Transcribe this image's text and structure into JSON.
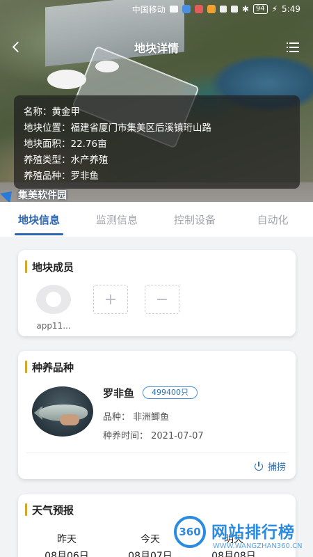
{
  "status_bar": {
    "carrier": "中国移动",
    "battery": "94",
    "time": "5:49"
  },
  "header": {
    "title": "地块详情"
  },
  "map": {
    "place_label": "集美软件园"
  },
  "plot_info": {
    "rows": [
      {
        "label": "名称：",
        "value": "黄金甲"
      },
      {
        "label": "地块位置：",
        "value": "福建省厦门市集美区后溪镇珩山路"
      },
      {
        "label": "地块面积：",
        "value": "22.76亩"
      },
      {
        "label": "养殖类型：",
        "value": "水产养殖"
      },
      {
        "label": "养殖品种：",
        "value": "罗非鱼"
      }
    ]
  },
  "tabs": [
    {
      "label": "地块信息",
      "active": true
    },
    {
      "label": "监测信息",
      "active": false
    },
    {
      "label": "控制设备",
      "active": false
    },
    {
      "label": "自动化",
      "active": false
    }
  ],
  "members_card": {
    "title": "地块成员",
    "member_name": "app11...",
    "add_symbol": "+",
    "remove_symbol": "−"
  },
  "species_card": {
    "title": "种养品种",
    "name": "罗非鱼",
    "count_badge": "499400只",
    "variety_line": "品种：  非洲鲫鱼",
    "time_line": "种养时间：  2021-07-07",
    "harvest_label": "捕捞"
  },
  "weather_card": {
    "title": "天气预报",
    "days": [
      {
        "label": "昨天",
        "date": "08月06日"
      },
      {
        "label": "今天",
        "date": "08月07日"
      },
      {
        "label": "明天",
        "date": "08月08日"
      }
    ]
  },
  "watermark": {
    "logo_text": "360",
    "title": "网站排行榜",
    "url": "WWW.WANGZHAN360.CN"
  },
  "colors": {
    "accent": "#2a66b3",
    "title_marker": "#d4a52a",
    "tab_inactive": "#a2a6ad"
  }
}
